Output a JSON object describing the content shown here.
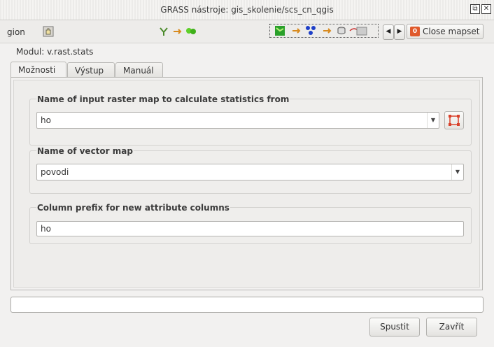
{
  "window": {
    "title": "GRASS nástroje: gis_skolenie/scs_cn_qgis",
    "restore_glyph": "⧉",
    "close_glyph": "✕"
  },
  "toolbar": {
    "partial_label": "gion",
    "close_mapset_label": "Close mapset",
    "nav_prev": "◀",
    "nav_next": "▶"
  },
  "module": {
    "label": "Modul: v.rast.stats"
  },
  "tabs": [
    {
      "label": "Možnosti",
      "active": true
    },
    {
      "label": "Výstup",
      "active": false
    },
    {
      "label": "Manuál",
      "active": false
    }
  ],
  "options": {
    "raster": {
      "title": "Name of input raster map to calculate statistics from",
      "value": "ho"
    },
    "vector": {
      "title": "Name of vector map",
      "value": "povodi"
    },
    "prefix": {
      "title": "Column prefix for new attribute columns",
      "value": "ho"
    }
  },
  "status": {
    "value": ""
  },
  "buttons": {
    "run": "Spustit",
    "close": "Zavřít"
  },
  "colors": {
    "accent_close": "#e05a2c",
    "selector_red": "#d9412b"
  },
  "icons": [
    "hand-icon",
    "fork-icon",
    "arrow-right-icon",
    "raster-map-icon",
    "vector-map-icon",
    "selection-icon"
  ]
}
